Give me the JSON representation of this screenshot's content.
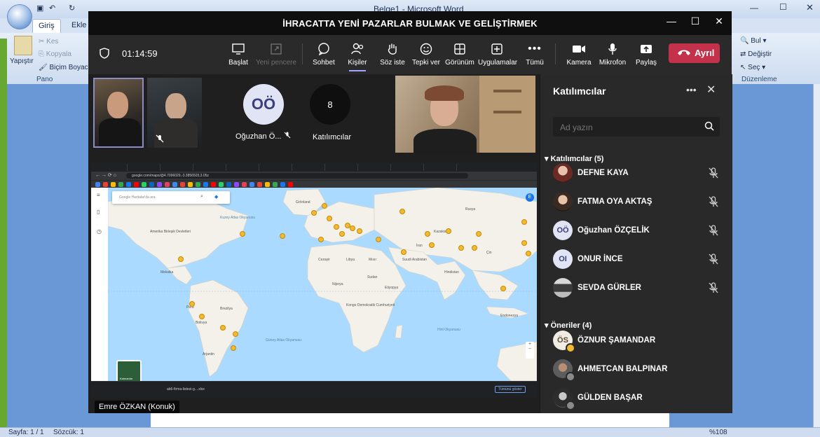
{
  "word": {
    "title": "Belge1 - Microsoft Word",
    "tabs": [
      "Giriş",
      "Ekle"
    ],
    "clipboard": {
      "paste": "Yapıştır",
      "cut": "Kes",
      "copy": "Kopyala",
      "format_painter": "Biçim Boyacısı",
      "group": "Pano"
    },
    "editing": {
      "find": "Bul",
      "replace": "Değiştir",
      "select": "Seç",
      "group": "Düzenleme"
    },
    "status": {
      "page": "Sayfa: 1 / 1",
      "words": "Sözcük: 1",
      "zoom": "%108"
    }
  },
  "teams": {
    "meeting_title": "İHRACATTA YENİ PAZARLAR BULMAK VE GELİŞTİRMEK",
    "timer": "01:14:59",
    "toolbar": {
      "start": "Başlat",
      "new_window": "Yeni pencere",
      "chat": "Sohbet",
      "people": "Kişiler",
      "raise_hand": "Söz iste",
      "react": "Tepki ver",
      "view": "Görünüm",
      "apps": "Uygulamalar",
      "more": "Tümü",
      "camera": "Kamera",
      "mic": "Mikrofon",
      "share": "Paylaş",
      "leave": "Ayrıl"
    },
    "stage": {
      "participant_initials": "OÖ",
      "participant_name": "Oğuzhan Ö...",
      "hidden_count": "8",
      "hidden_label": "Katılımcılar",
      "presenter_tag": "Emre ÖZKAN (Konuk)",
      "map_search_placeholder": "Google Haritalar'da ara",
      "url": "google.com/maps/@4.7096029,-3.3856503,3.05z",
      "layers_label": "Katmanlar",
      "map_labels": {
        "atlantic_n": "Kuzey Atlas Okyanusu",
        "atlantic_s": "Güney Atlas Okyanusu",
        "indian": "Hint Okyanusu",
        "brazil": "Brezilya",
        "algeria": "Cezayir",
        "libya": "Libya",
        "egypt": "Mısır",
        "nigeria": "Nijerya",
        "congo": "Kongo Demokratik Cumhuriyeti",
        "kazakhstan": "Kazakistan",
        "iran": "İran",
        "india": "Hindistan",
        "china": "Çin",
        "saudi": "Suudi Arabistan",
        "sudan": "Sudan",
        "ethiopia": "Etiyopya",
        "mexico": "Meksika",
        "peru": "Peru",
        "bolivia": "Bolivya",
        "argentina": "Arjantin",
        "russia": "Rusya",
        "greenland": "Grönland",
        "indonesia": "Endonezya",
        "usa": "Amerika Birleşik Devletleri"
      },
      "taskbar_file": "ab6-firma-listesi-g....xlsx",
      "taskbar_btn": "Tümünü göster"
    },
    "panel": {
      "title": "Katılımcılar",
      "search_placeholder": "Ad yazın",
      "section_participants": "Katılımcılar (5)",
      "section_suggestions": "Öneriler (4)",
      "participants": [
        {
          "name": "DEFNE KAYA",
          "initials": ""
        },
        {
          "name": "FATMA OYA AKTAŞ",
          "initials": ""
        },
        {
          "name": "Oğuzhan ÖZÇELİK",
          "initials": "OÖ"
        },
        {
          "name": "ONUR İNCE",
          "initials": "OI"
        },
        {
          "name": "SEVDA GÜRLER",
          "initials": ""
        }
      ],
      "suggestions": [
        {
          "name": "ÖZNUR ŞAMANDAR",
          "initials": "ÖS"
        },
        {
          "name": "AHMETCAN BALPINAR",
          "initials": ""
        },
        {
          "name": "GÜLDEN BAŞAR",
          "initials": ""
        }
      ]
    }
  },
  "colors": {
    "teams_bg": "#1f1f1f",
    "leave_red": "#c4314b",
    "accent": "#a3a6ff",
    "pin": "#f2b933",
    "ocean": "#aadaff",
    "land": "#f3f1ea"
  }
}
